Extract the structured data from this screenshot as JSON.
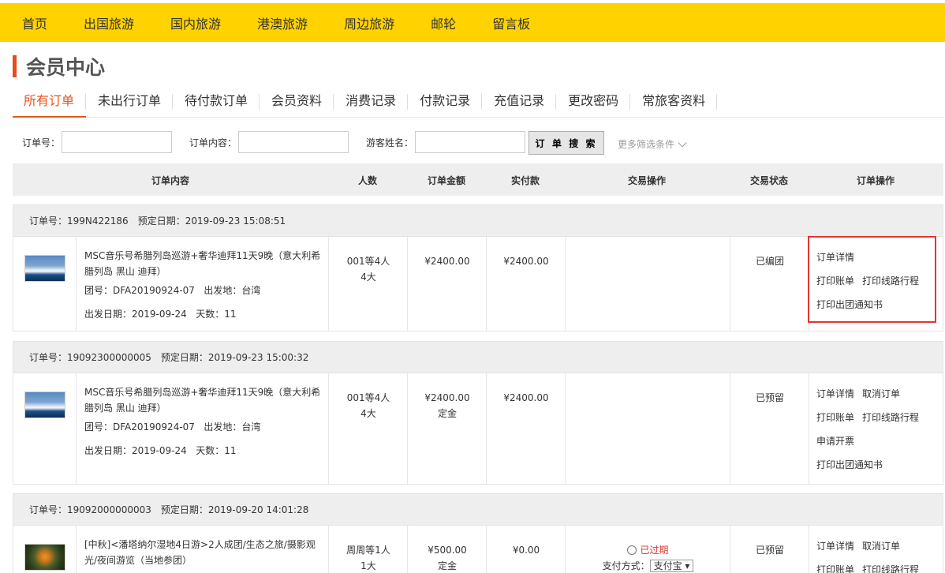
{
  "nav": {
    "items": [
      "首页",
      "出国旅游",
      "国内旅游",
      "港澳旅游",
      "周边旅游",
      "邮轮",
      "留言板"
    ]
  },
  "member": {
    "title": "会员中心"
  },
  "tabs": [
    "所有订单",
    "未出行订单",
    "待付款订单",
    "会员资料",
    "消费记录",
    "付款记录",
    "充值记录",
    "更改密码",
    "常旅客资料"
  ],
  "filters": {
    "order_no_label": "订单号：",
    "content_label": "订单内容：",
    "guest_label": "游客姓名：",
    "search_button": "订 单 搜 索",
    "more": "更多筛选条件"
  },
  "table": {
    "headers": [
      "订单内容",
      "人数",
      "订单金额",
      "实付款",
      "交易操作",
      "交易状态",
      "订单操作"
    ]
  },
  "orders": [
    {
      "order_no": "订单号：199N422186",
      "booking_date": "预定日期：2019-09-23 15:08:51",
      "title": "MSC音乐号希腊列岛巡游+奢华迪拜11天9晚（意大利希腊列岛 黑山 迪拜）",
      "group": "团号：DFA20190924-07",
      "origin": "出发地：台湾",
      "depart": "出发日期：2019-09-24",
      "days": "天数：11",
      "people": "001等4人",
      "people2": "4大",
      "amount": "¥2400.00",
      "amount_note": "",
      "paid": "¥2400.00",
      "status": "已编团",
      "ops": [
        "订单详情",
        "打印账单",
        "打印线路行程",
        "打印出团通知书"
      ]
    },
    {
      "order_no": "订单号：19092300000005",
      "booking_date": "预定日期：2019-09-23 15:00:32",
      "title": "MSC音乐号希腊列岛巡游+奢华迪拜11天9晚（意大利希腊列岛 黑山 迪拜）",
      "group": "团号：DFA20190924-07",
      "origin": "出发地：台湾",
      "depart": "出发日期：2019-09-24",
      "days": "天数：11",
      "people": "001等4人",
      "people2": "4大",
      "amount": "¥2400.00",
      "amount_note": "定金",
      "paid": "¥2400.00",
      "status": "已预留",
      "ops": [
        "订单详情",
        "取消订单",
        "打印账单",
        "打印线路行程",
        "申请开票",
        "打印出团通知书"
      ]
    },
    {
      "order_no": "订单号：19092000000003",
      "booking_date": "预定日期：2019-09-20 14:01:28",
      "title": "[中秋]<潘塔纳尔湿地4日游>2人成团/生态之旅/摄影观光/夜间游览（当地参团）",
      "people": "周周等1人",
      "people2": "1大",
      "amount": "¥500.00",
      "amount_note": "定金",
      "paid": "¥0.00",
      "expired": "已过期",
      "pay_method_label": "支付方式：",
      "pay_method": "支付宝",
      "status": "已预留",
      "ops": [
        "订单详情",
        "取消订单",
        "打印账单",
        "打印线路行程"
      ]
    }
  ]
}
